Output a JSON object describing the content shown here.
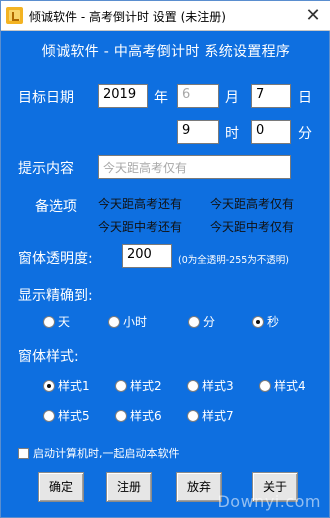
{
  "window": {
    "title": "倾诚软件 - 高考倒计时 设置 (未注册)",
    "close_glyph": "✕",
    "heading": "倾诚软件 - 中高考倒计时 系统设置程序"
  },
  "target_date": {
    "label": "目标日期",
    "year_value": "2019",
    "year_unit": "年",
    "month_value": "6",
    "month_unit": "月",
    "day_value": "7",
    "day_unit": "日",
    "hour_value": "9",
    "hour_unit": "时",
    "minute_value": "0",
    "minute_unit": "分"
  },
  "prompt": {
    "label": "提示内容",
    "value": "今天距高考仅有"
  },
  "options": {
    "label": "备选项",
    "items": [
      "今天距高考还有",
      "今天距高考仅有",
      "今天距中考还有",
      "今天距中考仅有"
    ]
  },
  "transparency": {
    "label": "窗体透明度:",
    "value": "200",
    "hint": "(0为全透明-255为不透明)"
  },
  "precision": {
    "label": "显示精确到:",
    "options": [
      "天",
      "小时",
      "分",
      "秒"
    ],
    "selected": "秒"
  },
  "style": {
    "label": "窗体样式:",
    "options": [
      "样式1",
      "样式2",
      "样式3",
      "样式4",
      "样式5",
      "样式6",
      "样式7"
    ],
    "selected": "样式1"
  },
  "autostart": {
    "label": "启动计算机时,一起启动本软件",
    "checked": false
  },
  "buttons": {
    "ok": "确定",
    "register": "注册",
    "abandon": "放弃",
    "about": "关于"
  },
  "watermark": "Downyi.com"
}
